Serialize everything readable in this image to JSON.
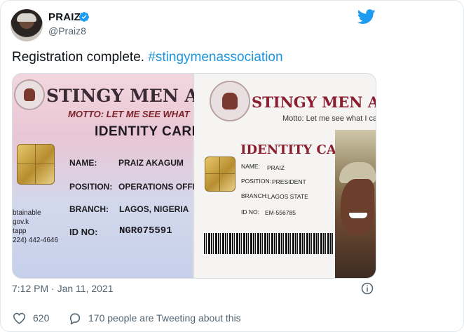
{
  "user": {
    "display_name": "PRAIZ",
    "handle": "@Praiz8",
    "verified": true
  },
  "tweet": {
    "text": "Registration complete.",
    "hashtag": "#stingymenassociation"
  },
  "card_left": {
    "title": "STINGY MEN ASS",
    "motto": "MOTTO: LET ME SEE WHAT",
    "heading": "IDENTITY CARD",
    "fields": [
      {
        "label": "NAME:",
        "value": "PRAIZ AKAGUM"
      },
      {
        "label": "POSITION:",
        "value": "OPERATIONS OFFICER"
      },
      {
        "label": "BRANCH:",
        "value": "LAGOS, NIGERIA"
      },
      {
        "label": "ID NO:",
        "value": "NGR075591"
      }
    ],
    "side_text": [
      "btainable",
      "gov.k",
      "tapp",
      "224) 442-4646"
    ]
  },
  "card_right": {
    "title": "STINGY MEN ASSOC",
    "motto": "Motto: Let me see what I ca",
    "heading": "IDENTITY CARD",
    "fields": [
      {
        "label": "NAME:",
        "value": "PRAIZ"
      },
      {
        "label": "POSITION:",
        "value": "PRESIDENT"
      },
      {
        "label": "BRANCH:",
        "value": "LAGOS STATE"
      },
      {
        "label": "ID NO:",
        "value": "EM-556785"
      }
    ]
  },
  "meta": {
    "timestamp": "7:12 PM · Jan 11, 2021",
    "like_count": "620",
    "reply_text": "170 people are Tweeting about this"
  },
  "icons": {
    "brand": "twitter-bird-icon",
    "verified": "verified-badge-icon",
    "info": "info-icon",
    "like": "heart-icon",
    "reply": "speech-bubble-icon"
  },
  "colors": {
    "twitter_blue": "#1d9bf0",
    "hashtag": "#1b95e0",
    "muted": "#536471"
  }
}
